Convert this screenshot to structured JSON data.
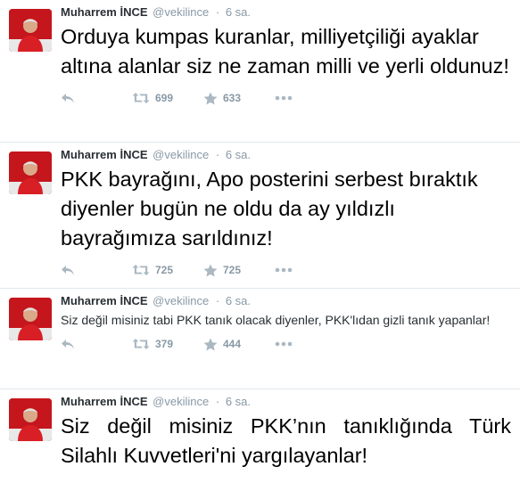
{
  "colors": {
    "name": "#292f33",
    "meta": "#8899a6",
    "divider": "#e1e8ed",
    "avatar_bg": "#c4161c"
  },
  "icons": {
    "reply": "reply-icon",
    "retweet": "retweet-icon",
    "favorite": "star-icon",
    "more": "more-icon"
  },
  "tweets": [
    {
      "author": "Muharrem İNCE",
      "handle": "@vekilince",
      "separator": "·",
      "time": "6 sa.",
      "text": "Orduya kumpas kuranlar, milliyetçiliği ayaklar altına alanlar siz ne zaman milli ve yerli oldunuz!",
      "retweets": "699",
      "favorites": "633"
    },
    {
      "author": "Muharrem İNCE",
      "handle": "@vekilince",
      "separator": "·",
      "time": "6 sa.",
      "text": "PKK bayrağını, Apo posterini serbest bıraktık diyenler bugün ne oldu da ay yıldızlı bayrağımıza sarıldınız!",
      "retweets": "725",
      "favorites": "725"
    },
    {
      "author": "Muharrem İNCE",
      "handle": "@vekilince",
      "separator": "·",
      "time": "6 sa.",
      "text": "Siz değil misiniz tabi PKK tanık olacak diyenler, PKK'lıdan gizli tanık yapanlar!",
      "retweets": "379",
      "favorites": "444"
    },
    {
      "author": "Muharrem İNCE",
      "handle": "@vekilince",
      "separator": "·",
      "time": "6 sa.",
      "text": "Siz değil misiniz PKK’nın tanıklığında Türk Silahlı Kuvvetleri'ni yargılayanlar!"
    }
  ]
}
